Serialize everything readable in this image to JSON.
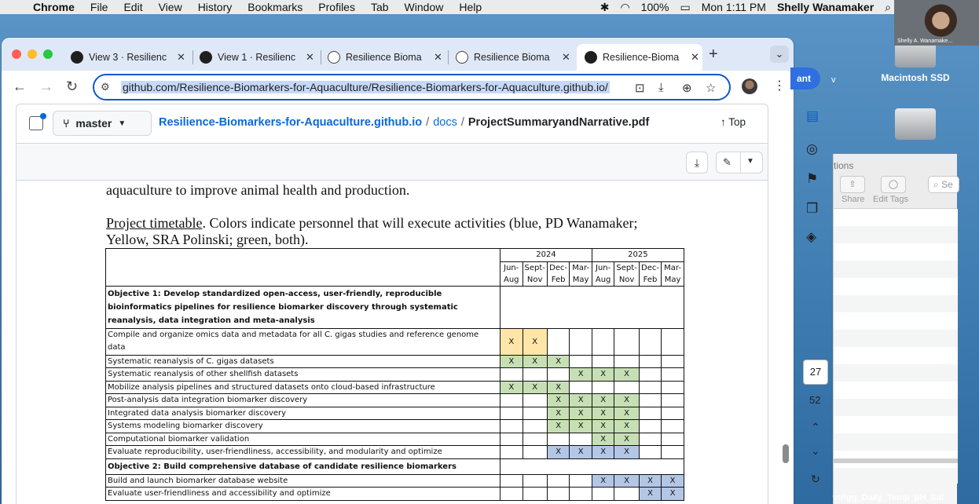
{
  "menubar": {
    "app": "Chrome",
    "items": [
      "File",
      "Edit",
      "View",
      "History",
      "Bookmarks",
      "Profiles",
      "Tab",
      "Window",
      "Help"
    ],
    "battery": "100%",
    "clock": "Mon 1:11 PM",
    "user": "Shelly Wanamaker"
  },
  "webcam": {
    "caption": "Shelly A. Wanamake..."
  },
  "desktop": {
    "disk_label": "Macintosh SSD",
    "side_window": {
      "title_partial": "tions",
      "share_label": "Share",
      "edit_tags_label": "Edit Tags",
      "search_partial": "Se"
    },
    "bottom_label": "vtrigg_Daily_Temp_pH_Sal",
    "partial_button": "ant",
    "partial_v": "v"
  },
  "tabs": [
    {
      "label": "View 3 · Resilienc",
      "icon": "github-icon"
    },
    {
      "label": "View 1 · Resilienc",
      "icon": "github-icon"
    },
    {
      "label": "Resilience Bioma",
      "icon": "globe-icon"
    },
    {
      "label": "Resilience Bioma",
      "icon": "globe-icon"
    },
    {
      "label": "Resilience-Bioma",
      "icon": "github-icon",
      "active": true
    }
  ],
  "omnibox": {
    "url": "github.com/Resilience-Biomarkers-for-Aquaculture/Resilience-Biomarkers-for-Aquaculture.github.io/"
  },
  "github": {
    "branch": "master",
    "repo": "Resilience-Biomarkers-for-Aquaculture.github.io",
    "folder": "docs",
    "file": "ProjectSummaryandNarrative.pdf",
    "top_label": "Top"
  },
  "pdf": {
    "line1": "aquaculture to improve animal health and production.",
    "timetable_link": "Project timetable",
    "line2_rest": ". Colors indicate personnel that will execute activities (blue, PD Wanamaker;",
    "line3": "Yellow, SRA Polinski; green, both).",
    "years": [
      "2024",
      "2025"
    ],
    "periods_top": [
      "Jun-",
      "Sept-",
      "Dec-",
      "Mar-",
      "Jun-",
      "Sept-",
      "Dec-",
      "Mar-"
    ],
    "periods_bottom": [
      "Aug",
      "Nov",
      "Feb",
      "May",
      "Aug",
      "Nov",
      "Feb",
      "May"
    ],
    "objective1": "Objective 1: Develop standardized open-access, user-friendly, reproducible bioinformatics pipelines for resilience biomarker discovery through systematic reanalysis, data integration and meta-analysis",
    "objective2": "Objective 2: Build comprehensive database of candidate resilience biomarkers",
    "rows": [
      {
        "task": "Compile and organize omics data and metadata for all C. gigas studies and reference genome data",
        "cells": [
          "y",
          "y",
          "",
          "",
          "",
          "",
          "",
          ""
        ]
      },
      {
        "task": "Systematic reanalysis of C. gigas datasets",
        "cells": [
          "g",
          "g",
          "g",
          "",
          "",
          "",
          "",
          ""
        ]
      },
      {
        "task": "Systematic reanalysis of other shellfish datasets",
        "cells": [
          "",
          "",
          "",
          "g",
          "g",
          "g",
          "",
          ""
        ]
      },
      {
        "task": "Mobilize analysis pipelines and structured datasets onto cloud-based infrastructure",
        "cells": [
          "g",
          "g",
          "g",
          "",
          "",
          "",
          "",
          ""
        ]
      },
      {
        "task": "Post-analysis data integration biomarker discovery",
        "cells": [
          "",
          "",
          "g",
          "g",
          "g",
          "g",
          "",
          ""
        ]
      },
      {
        "task": "Integrated data analysis biomarker discovery",
        "cells": [
          "",
          "",
          "g",
          "g",
          "g",
          "g",
          "",
          ""
        ]
      },
      {
        "task": "Systems modeling biomarker discovery",
        "cells": [
          "",
          "",
          "g",
          "g",
          "g",
          "g",
          "",
          ""
        ]
      },
      {
        "task": "Computational biomarker validation",
        "cells": [
          "",
          "",
          "",
          "",
          "g",
          "g",
          "",
          ""
        ]
      },
      {
        "task": "Evaluate reproducibility, user-friendliness, accessibility, and modularity and optimize",
        "cells": [
          "",
          "",
          "b",
          "b",
          "b",
          "b",
          "",
          ""
        ]
      }
    ],
    "rows2": [
      {
        "task": "Build and launch biomarker database website",
        "cells": [
          "",
          "",
          "",
          "",
          "b",
          "b",
          "b",
          "b"
        ]
      },
      {
        "task": "Evaluate user-friendliness and accessibility and optimize",
        "cells": [
          "",
          "",
          "",
          "",
          "",
          "",
          "b",
          "b"
        ]
      }
    ],
    "mark": "X"
  },
  "pager": {
    "current": "27",
    "total": "52"
  },
  "colors": {
    "yellow": "#ffe6a8",
    "green": "#c6dfb4",
    "blue": "#b3c6e6",
    "accent": "#0b57d0"
  }
}
